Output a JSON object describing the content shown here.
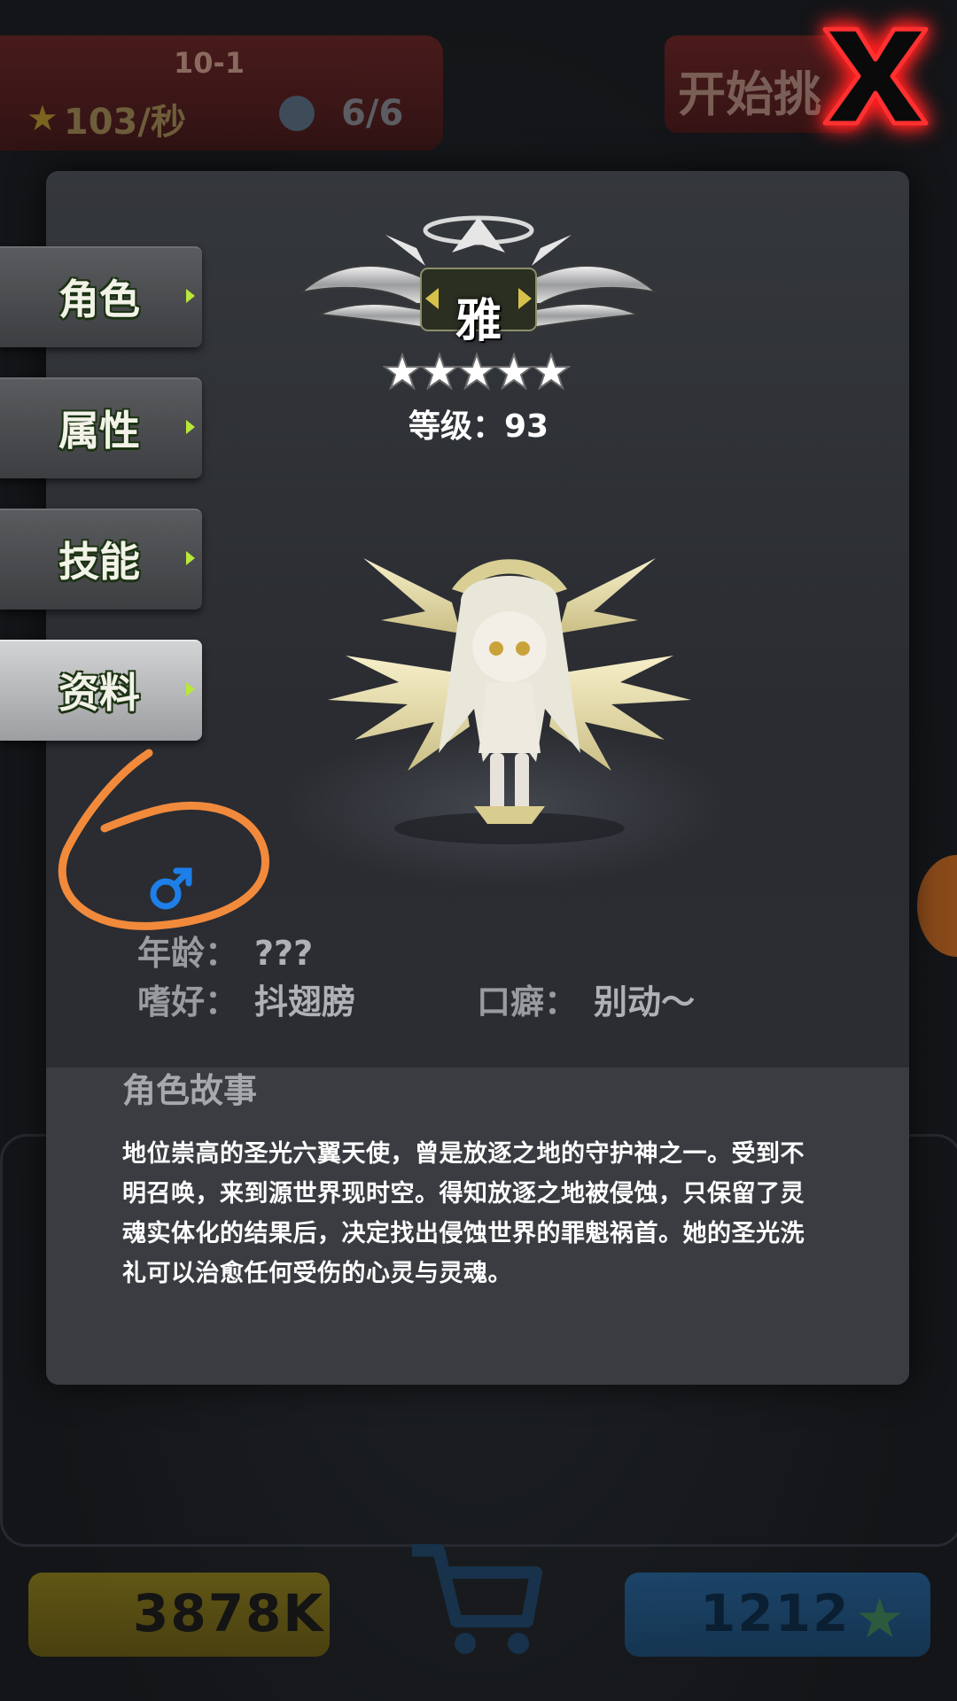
{
  "background": {
    "stage": "10-1",
    "rate": "103/秒",
    "team": "6/6",
    "start_button": "开始挑",
    "coins": "3878K",
    "gems": "1212"
  },
  "tabs": [
    {
      "label": "角色",
      "active": false
    },
    {
      "label": "属性",
      "active": false
    },
    {
      "label": "技能",
      "active": false
    },
    {
      "label": "资料",
      "active": true
    }
  ],
  "character": {
    "name": "雅",
    "stars": 5,
    "level_label": "等级：93"
  },
  "profile": {
    "gender_icon": "male-symbol-icon",
    "age_label": "年龄：",
    "age_value": "???",
    "hobby_label": "嗜好：",
    "hobby_value": "抖翅膀",
    "catchphrase_label": "口癖：",
    "catchphrase_value": "别动～"
  },
  "story": {
    "title": "角色故事",
    "text": "地位崇高的圣光六翼天使，曾是放逐之地的守护神之一。受到不明召唤，来到源世界现时空。得知放逐之地被侵蚀，只保留了灵魂实体化的结果后，决定找出侵蚀世界的罪魁祸首。她的圣光洗礼可以治愈任何受伤的心灵与灵魂。"
  },
  "colors": {
    "tab_arrow": "#b8e83a",
    "close_glow": "#ff1a1a",
    "annotation": "#f28a3c",
    "gender_icon": "#1e7fe8"
  }
}
